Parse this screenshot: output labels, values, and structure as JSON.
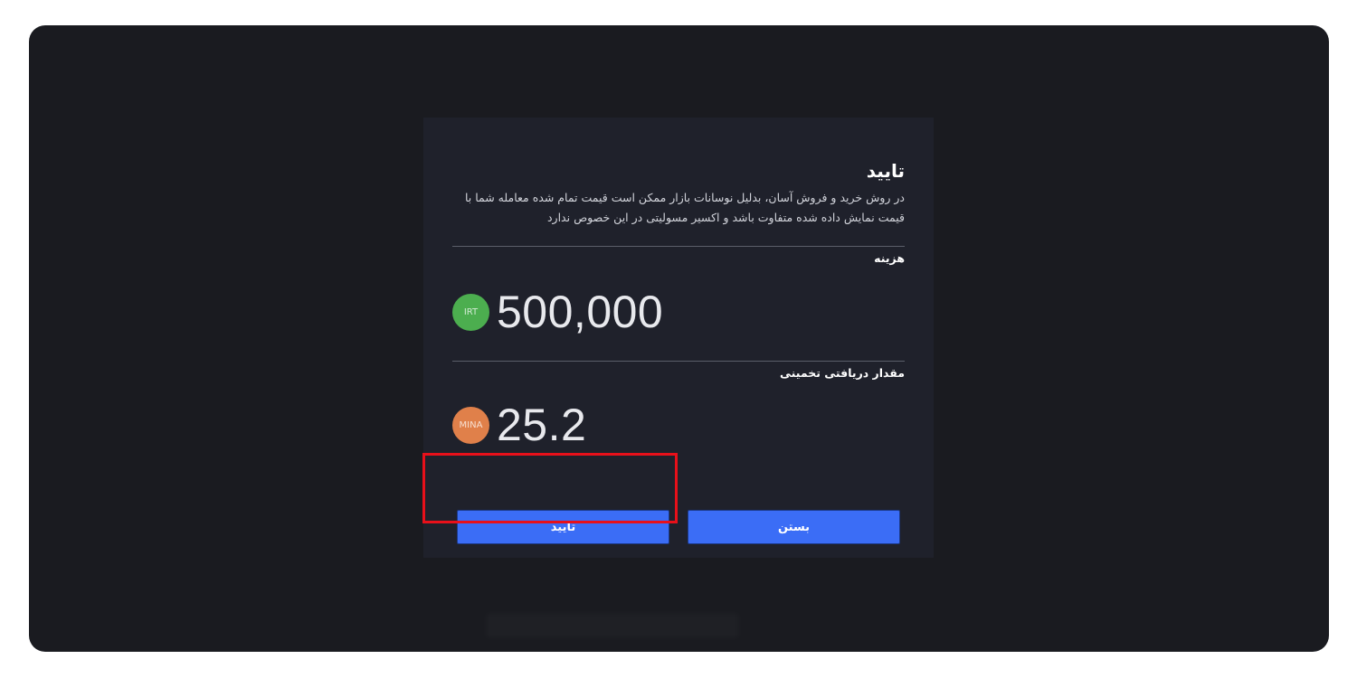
{
  "modal": {
    "title": "تایید",
    "description": "در روش خرید و فروش آسان، بدلیل نوسانات بازار ممکن است قیمت تمام شده معامله شما با قیمت نمایش داده شده متفاوت باشد و اکسیر مسولیتی در این خصوص ندارد",
    "cost": {
      "label": "هزینه",
      "currency": "IRT",
      "currency_color": "#4cae4f",
      "amount": "500,000"
    },
    "estimated": {
      "label": "مقدار دریافتی تخمینی",
      "currency": "MINA",
      "currency_color": "#e0804a",
      "amount": "25.2"
    },
    "buttons": {
      "close_label": "بستن",
      "confirm_label": "تایید"
    }
  },
  "colors": {
    "accent": "#3b6df6",
    "highlight": "#e8101a",
    "background": "#1a1b20",
    "modal_background": "#1f212b"
  }
}
